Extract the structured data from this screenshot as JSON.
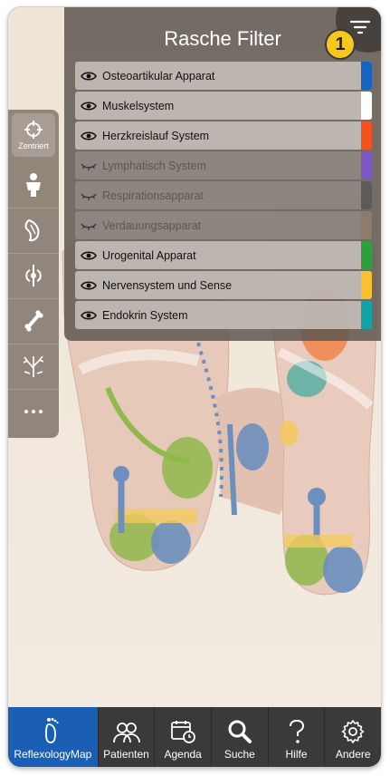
{
  "panel": {
    "title": "Rasche Filter",
    "badge": "1",
    "filter_icon": "filter-lines-icon"
  },
  "filters": [
    {
      "label": "Osteoartikular Apparat",
      "visible": true,
      "color": "#1565c0"
    },
    {
      "label": "Muskelsystem",
      "visible": true,
      "color": "#ffffff"
    },
    {
      "label": "Herzkreislauf System",
      "visible": true,
      "color": "#f4511e"
    },
    {
      "label": "Lymphatisch System",
      "visible": false,
      "color": "#7e57c2"
    },
    {
      "label": "Respirationsapparat",
      "visible": false,
      "color": "#5d5a58"
    },
    {
      "label": "Verdauungsapparat",
      "visible": false,
      "color": "#8d7b6d"
    },
    {
      "label": "Urogenital Apparat",
      "visible": true,
      "color": "#2e9e3e"
    },
    {
      "label": "Nervensystem und Sense",
      "visible": true,
      "color": "#fbc02d"
    },
    {
      "label": "Endokrin System",
      "visible": true,
      "color": "#12a4a4"
    }
  ],
  "toolbar": {
    "centered_label": "Zentriert",
    "tools": [
      "body-icon",
      "muscle-icon",
      "organ-icon",
      "bone-icon",
      "nerve-icon",
      "more-icon"
    ]
  },
  "tabs": [
    {
      "label": "ReflexologyMap",
      "icon": "foot-icon",
      "active": true
    },
    {
      "label": "Patienten",
      "icon": "patients-icon",
      "active": false
    },
    {
      "label": "Agenda",
      "icon": "calendar-icon",
      "active": false
    },
    {
      "label": "Suche",
      "icon": "search-icon",
      "active": false
    },
    {
      "label": "Hilfe",
      "icon": "help-icon",
      "active": false
    },
    {
      "label": "Andere",
      "icon": "gear-icon",
      "active": false
    }
  ]
}
